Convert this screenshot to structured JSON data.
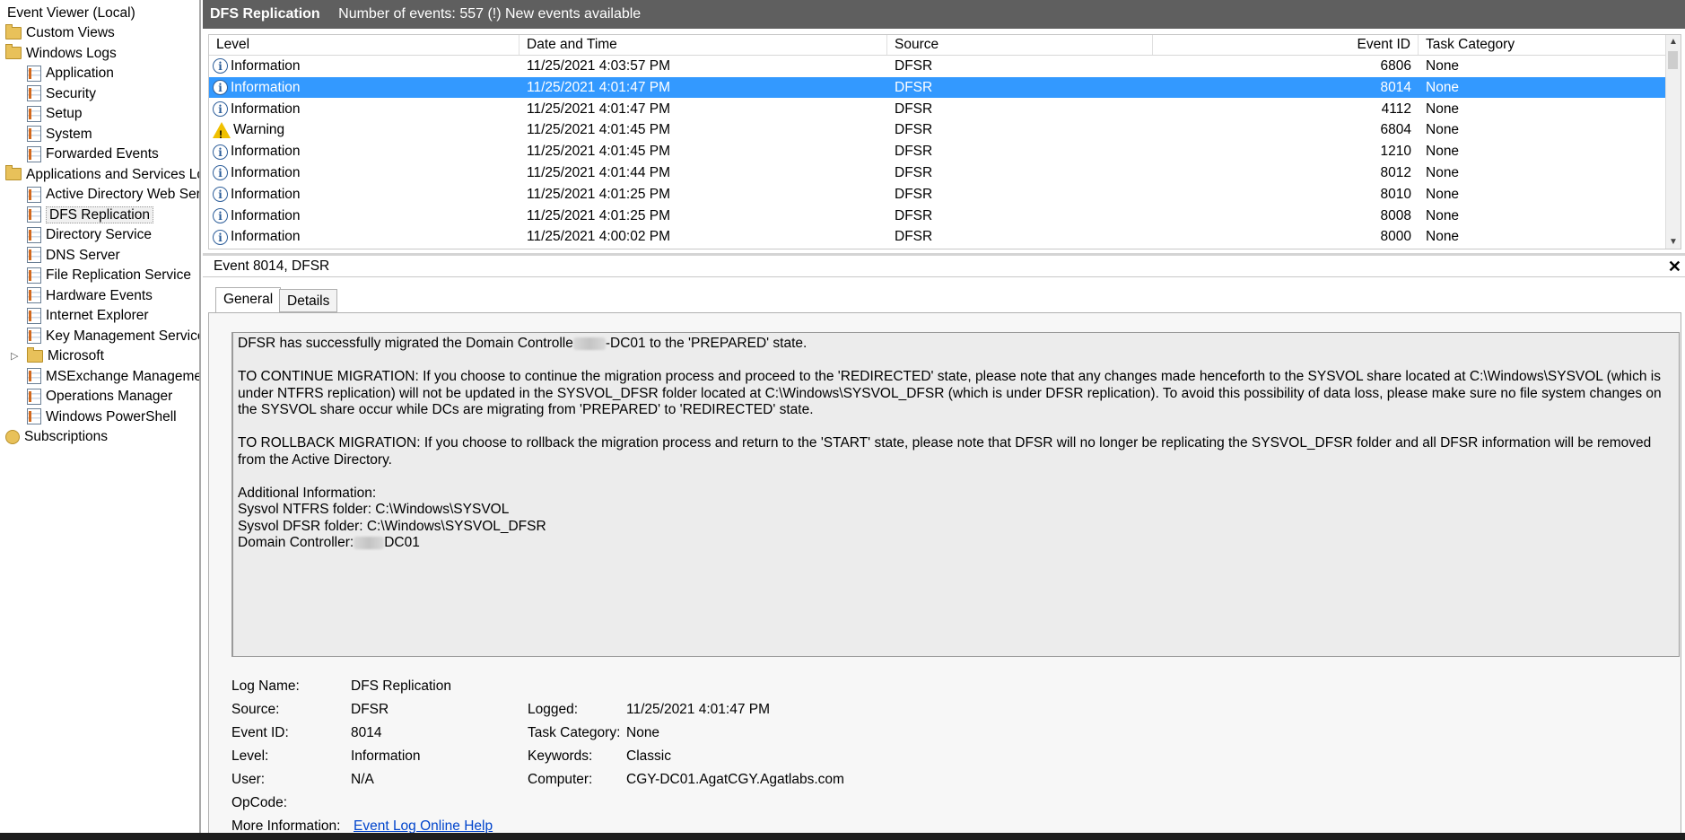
{
  "tree": {
    "root": "Event Viewer (Local)",
    "items": [
      {
        "label": "Custom Views",
        "icon": "folder-icon"
      },
      {
        "label": "Windows Logs",
        "icon": "folder-icon"
      },
      {
        "label": "Application",
        "icon": "event-log-icon"
      },
      {
        "label": "Security",
        "icon": "event-log-icon"
      },
      {
        "label": "Setup",
        "icon": "event-log-icon"
      },
      {
        "label": "System",
        "icon": "event-log-icon"
      },
      {
        "label": "Forwarded Events",
        "icon": "event-log-icon"
      },
      {
        "label": "Applications and Services Lo",
        "icon": "folder-icon"
      },
      {
        "label": "Active Directory Web Ser",
        "icon": "event-log-icon"
      },
      {
        "label": "DFS Replication",
        "icon": "event-log-icon"
      },
      {
        "label": "Directory Service",
        "icon": "event-log-icon"
      },
      {
        "label": "DNS Server",
        "icon": "event-log-icon"
      },
      {
        "label": "File Replication Service",
        "icon": "event-log-icon"
      },
      {
        "label": "Hardware Events",
        "icon": "event-log-icon"
      },
      {
        "label": "Internet Explorer",
        "icon": "event-log-icon"
      },
      {
        "label": "Key Management Service",
        "icon": "event-log-icon"
      },
      {
        "label": "Microsoft",
        "icon": "folder-icon"
      },
      {
        "label": "MSExchange Manageme",
        "icon": "event-log-icon"
      },
      {
        "label": "Operations Manager",
        "icon": "event-log-icon"
      },
      {
        "label": "Windows PowerShell",
        "icon": "event-log-icon"
      },
      {
        "label": "Subscriptions",
        "icon": "subscriptions-icon"
      }
    ],
    "selected": "DFS Replication"
  },
  "header": {
    "title": "DFS Replication",
    "status": "Number of events: 557 (!) New events available"
  },
  "grid": {
    "columns": [
      "Level",
      "Date and Time",
      "Source",
      "Event ID",
      "Task Category"
    ],
    "rows": [
      {
        "level": "Information",
        "date": "11/25/2021 4:03:57 PM",
        "source": "DFSR",
        "id": "6806",
        "category": "None"
      },
      {
        "level": "Information",
        "date": "11/25/2021 4:01:47 PM",
        "source": "DFSR",
        "id": "8014",
        "category": "None"
      },
      {
        "level": "Information",
        "date": "11/25/2021 4:01:47 PM",
        "source": "DFSR",
        "id": "4112",
        "category": "None"
      },
      {
        "level": "Warning",
        "date": "11/25/2021 4:01:45 PM",
        "source": "DFSR",
        "id": "6804",
        "category": "None"
      },
      {
        "level": "Information",
        "date": "11/25/2021 4:01:45 PM",
        "source": "DFSR",
        "id": "1210",
        "category": "None"
      },
      {
        "level": "Information",
        "date": "11/25/2021 4:01:44 PM",
        "source": "DFSR",
        "id": "8012",
        "category": "None"
      },
      {
        "level": "Information",
        "date": "11/25/2021 4:01:25 PM",
        "source": "DFSR",
        "id": "8010",
        "category": "None"
      },
      {
        "level": "Information",
        "date": "11/25/2021 4:01:25 PM",
        "source": "DFSR",
        "id": "8008",
        "category": "None"
      },
      {
        "level": "Information",
        "date": "11/25/2021 4:00:02 PM",
        "source": "DFSR",
        "id": "8000",
        "category": "None"
      }
    ],
    "selected_index": 1
  },
  "detail": {
    "title": "Event 8014, DFSR",
    "tabs": [
      "General",
      "Details"
    ],
    "description": {
      "line1_a": "DFSR has successfully migrated the Domain Controlle",
      "line1_b": "-DC01 to the 'PREPARED' state.",
      "para2": "TO CONTINUE MIGRATION: If you choose to continue the migration process and proceed to the 'REDIRECTED' state, please note that any changes made henceforth to the SYSVOL share located at C:\\Windows\\SYSVOL (which is under NTFRS replication) will not be updated in the SYSVOL_DFSR folder located at C:\\Windows\\SYSVOL_DFSR (which is under DFSR replication). To avoid this possibility of data loss, please make sure no file system changes on the SYSVOL share occur while DCs are migrating from 'PREPARED' to 'REDIRECTED' state.",
      "para3": "TO ROLLBACK MIGRATION: If you choose to rollback the migration process and return to the 'START' state, please note that DFSR will no longer be replicating the SYSVOL_DFSR folder and all DFSR information will be removed from the Active Directory.",
      "add_title": "Additional Information:",
      "add_1": "Sysvol NTFRS folder: C:\\Windows\\SYSVOL",
      "add_2": "Sysvol DFSR folder: C:\\Windows\\SYSVOL_DFSR",
      "add_3a": "Domain Controller:",
      "add_3b": "DC01"
    },
    "props": {
      "log_name_label": "Log Name:",
      "log_name": "DFS Replication",
      "source_label": "Source:",
      "source": "DFSR",
      "logged_label": "Logged:",
      "logged": "11/25/2021 4:01:47 PM",
      "event_id_label": "Event ID:",
      "event_id": "8014",
      "task_label": "Task Category:",
      "task": "None",
      "level_label": "Level:",
      "level": "Information",
      "keywords_label": "Keywords:",
      "keywords": "Classic",
      "user_label": "User:",
      "user": "N/A",
      "computer_label": "Computer:",
      "computer": "CGY-DC01.AgatCGY.Agatlabs.com",
      "opcode_label": "OpCode:",
      "more_label": "More Information:",
      "more_link": "Event Log Online Help"
    }
  },
  "colors": {
    "selection": "#3399ff",
    "titlebar": "#5f5f5f",
    "link": "#0044cc"
  }
}
